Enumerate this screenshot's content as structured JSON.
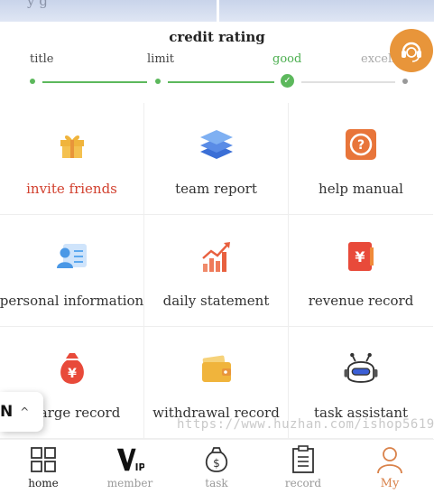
{
  "header_fragment": "y g",
  "credit": {
    "title": "credit rating",
    "stages": [
      "title",
      "limit",
      "good",
      "excell"
    ]
  },
  "grid": [
    {
      "label": "invite friends",
      "icon": "gift-icon"
    },
    {
      "label": "team report",
      "icon": "layers-icon"
    },
    {
      "label": "help manual",
      "icon": "help-icon"
    },
    {
      "label": "personal information",
      "icon": "contact-card-icon"
    },
    {
      "label": "daily statement",
      "icon": "bar-chart-icon"
    },
    {
      "label": "revenue record",
      "icon": "yen-envelope-icon"
    },
    {
      "label": "charge record",
      "icon": "money-bag-icon"
    },
    {
      "label": "withdrawal record",
      "icon": "wallet-icon"
    },
    {
      "label": "task assistant",
      "icon": "robot-icon"
    }
  ],
  "language": {
    "code": "N",
    "chevron": "^"
  },
  "watermark": "https://www.huzhan.com/ishop56196",
  "tabs": [
    {
      "label": "home",
      "icon": "home-grid-icon"
    },
    {
      "label": "member",
      "icon": "vip-icon"
    },
    {
      "label": "task",
      "icon": "money-bag-outline-icon"
    },
    {
      "label": "record",
      "icon": "clipboard-icon"
    },
    {
      "label": "My",
      "icon": "user-icon"
    }
  ],
  "colors": {
    "accent": "#e8953a",
    "success": "#4caf50",
    "highlight": "#d2412f"
  }
}
